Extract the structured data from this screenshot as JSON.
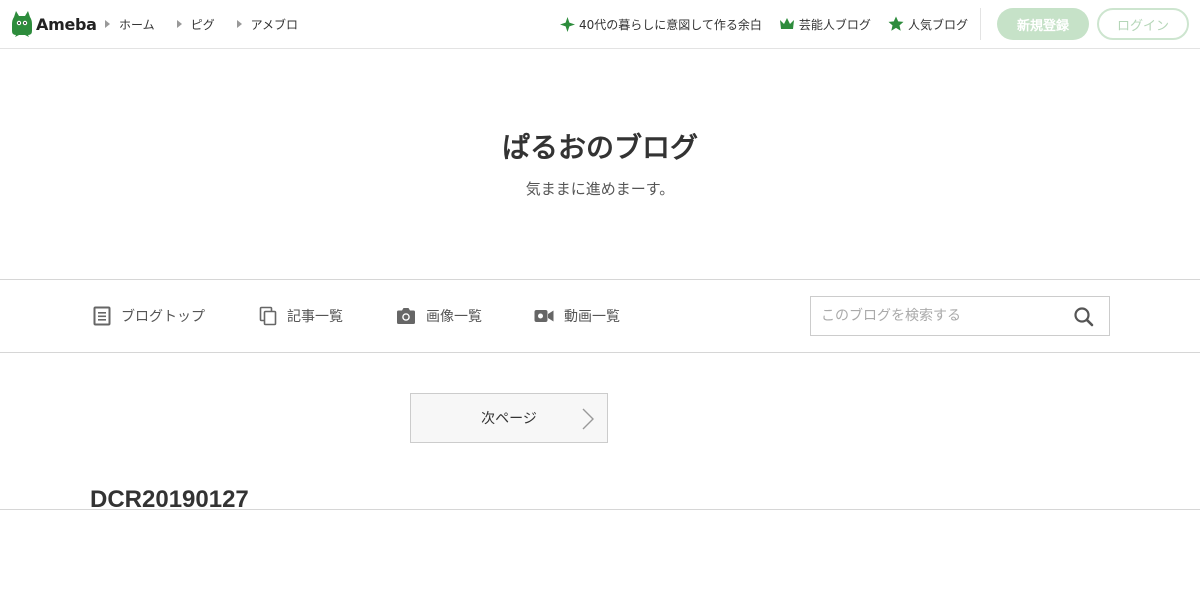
{
  "header": {
    "logo_text": "Ameba",
    "breadcrumbs": [
      "ホーム",
      "ピグ",
      "アメブロ"
    ],
    "nav": [
      {
        "label": "40代の暮らしに意図して作る余白",
        "icon": "sparkle-icon"
      },
      {
        "label": "芸能人ブログ",
        "icon": "crown-icon"
      },
      {
        "label": "人気ブログ",
        "icon": "star-icon"
      }
    ],
    "register_label": "新規登録",
    "login_label": "ログイン"
  },
  "blog": {
    "title": "ぱるおのブログ",
    "description": "気ままに進めまーす。"
  },
  "blog_nav": [
    {
      "label": "ブログトップ",
      "icon": "document-icon"
    },
    {
      "label": "記事一覧",
      "icon": "copy-icon"
    },
    {
      "label": "画像一覧",
      "icon": "camera-icon"
    },
    {
      "label": "動画一覧",
      "icon": "video-icon"
    }
  ],
  "search": {
    "placeholder": "このブログを検索する"
  },
  "pagination": {
    "next_label": "次ページ"
  },
  "entry": {
    "title": "DCR20190127"
  },
  "colors": {
    "brand_green": "#2d8c3c",
    "register_bg": "#c6e2c8"
  }
}
